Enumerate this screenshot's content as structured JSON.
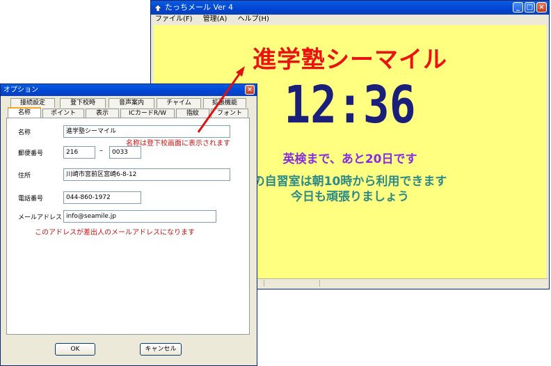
{
  "main": {
    "title": "たっちメール Ver 4",
    "menu": [
      "ファイル(F)",
      "管理(A)",
      "ヘルプ(H)"
    ],
    "window_buttons": [
      "_",
      "□",
      "×"
    ],
    "school_name": "進学塾シーマイル",
    "clock": "12:36",
    "message1": "英検まで、あと20日です",
    "message2": "の自習室は朝10時から利用できます",
    "message3": "今日も頑張りましょう",
    "colors": {
      "background": "#ffff80",
      "name": "#ee1111",
      "clock": "#1a1f7a"
    }
  },
  "dialog": {
    "title": "オプション",
    "close": "×",
    "tabs_row1": [
      "接続設定",
      "登下校時",
      "音声案内",
      "チャイム",
      "拡張機能"
    ],
    "tabs_row2": [
      "名称",
      "ポイント",
      "表示",
      "ICカードR/W",
      "指紋",
      "フォント"
    ],
    "active_tab": "名称",
    "fields": {
      "name_label": "名称",
      "name_value": "進学塾シーマイル",
      "postal_label": "郵便番号",
      "postal1": "216",
      "postal_dash": "–",
      "postal2": "0033",
      "address_label": "住所",
      "address_value": "川崎市宮前区宮崎6-8-12",
      "phone_label": "電話番号",
      "phone_value": "044-860-1972",
      "email_label": "メールアドレス",
      "email_value": "info@seamile.jp"
    },
    "ok": "OK",
    "cancel": "キャンセル"
  },
  "annotations": {
    "name_note": "名称は登下校画面に表示されます",
    "email_note": "このアドレスが差出人のメールアドレスになります"
  }
}
